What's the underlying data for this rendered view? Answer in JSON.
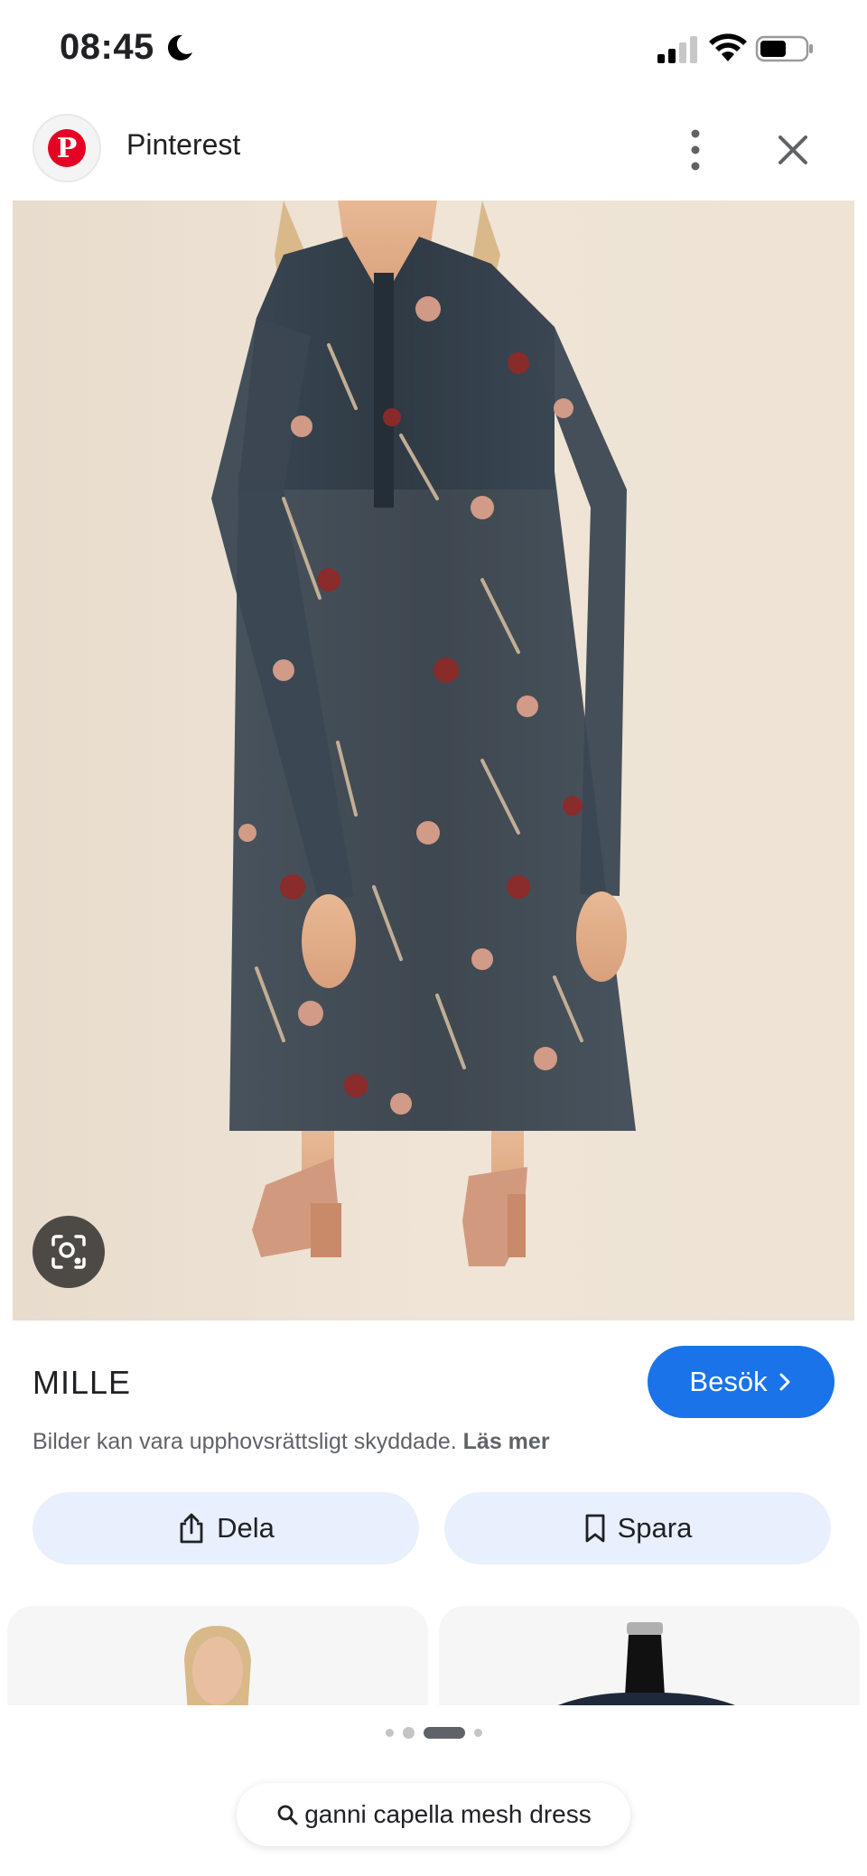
{
  "status_bar": {
    "time": "08:45"
  },
  "header": {
    "site_name": "Pinterest"
  },
  "result": {
    "brand": "MILLE",
    "visit_label": "Besök",
    "copyright_text": "Bilder kan vara upphovsrättsligt skyddade.",
    "read_more_label": "Läs mer"
  },
  "actions": {
    "share_label": "Dela",
    "save_label": "Spara"
  },
  "pager": {
    "total": 4,
    "active_index": 2
  },
  "search": {
    "query": "ganni capella mesh dress"
  },
  "colors": {
    "accent_blue": "#1a73e8",
    "action_bg": "#e8effd",
    "pinterest_red": "#e60023",
    "dress_navy": "#2f3a44"
  }
}
